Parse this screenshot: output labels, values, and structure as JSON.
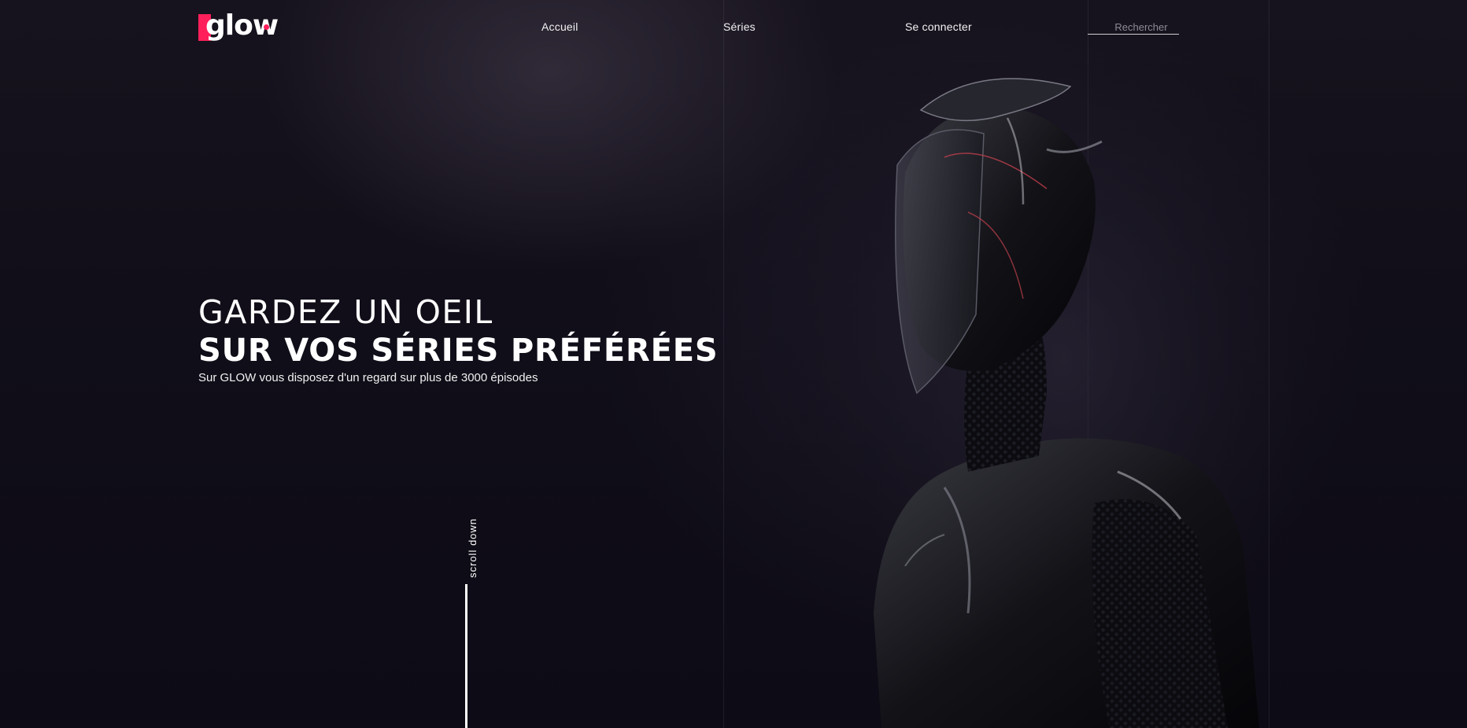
{
  "brand": {
    "name": "glow",
    "accent_color": "#ff1f5a"
  },
  "nav": {
    "items": [
      {
        "label": "Accueil"
      },
      {
        "label": "Séries"
      },
      {
        "label": "Se connecter"
      }
    ],
    "search": {
      "placeholder": "Rechercher",
      "value": ""
    }
  },
  "hero": {
    "title_line1": "GARDEZ UN OEIL",
    "title_line2": "SUR VOS SÉRIES PRÉFÉRÉES",
    "subtitle": "Sur GLOW vous disposez d'un regard sur plus de 3000 épisodes",
    "image": "armored-helmet-figure"
  },
  "scroll": {
    "label": "scroll down"
  }
}
